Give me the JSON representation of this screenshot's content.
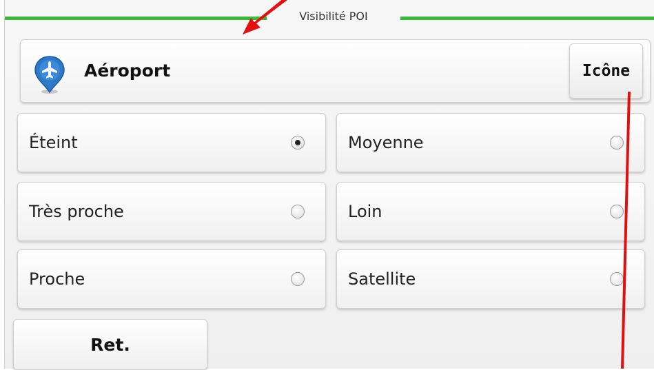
{
  "header": {
    "title": "Visibilité POI"
  },
  "poi": {
    "icon": "airplane-pin-icon",
    "label": "Aéroport",
    "icon_button_label": "Icône"
  },
  "options": [
    {
      "label": "Éteint",
      "selected": true
    },
    {
      "label": "Très proche",
      "selected": false
    },
    {
      "label": "Proche",
      "selected": false
    },
    {
      "label": "Moyenne",
      "selected": false
    },
    {
      "label": "Loin",
      "selected": false
    },
    {
      "label": "Satellite",
      "selected": false
    }
  ],
  "footer": {
    "back_label": "Ret."
  },
  "colors": {
    "title_line": "#3cb83c",
    "annotation": "#e01010",
    "poi_pin": "#2f78c8"
  }
}
